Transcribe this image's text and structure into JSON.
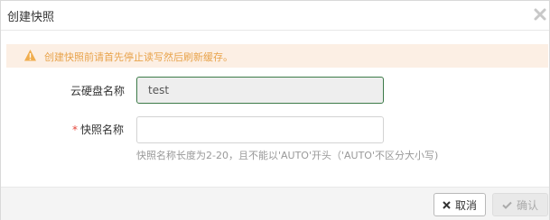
{
  "dialog": {
    "title": "创建快照"
  },
  "warning": {
    "text": "创建快照前请首先停止读写然后刷新缓存。",
    "color": "#e8a34b",
    "background": "#fcefe4"
  },
  "form": {
    "disk_label": "云硬盘名称",
    "disk_value": "test",
    "snapshot_required_mark": "*",
    "snapshot_label": "快照名称",
    "snapshot_value": "",
    "snapshot_hint": "快照名称长度为2-20，且不能以'AUTO'开头（'AUTO'不区分大小写)"
  },
  "footer": {
    "cancel_label": "取消",
    "confirm_label": "确认"
  },
  "icons": {
    "close": "close-icon",
    "warning": "warning-triangle-icon",
    "cancel": "x-icon",
    "confirm": "check-icon"
  }
}
